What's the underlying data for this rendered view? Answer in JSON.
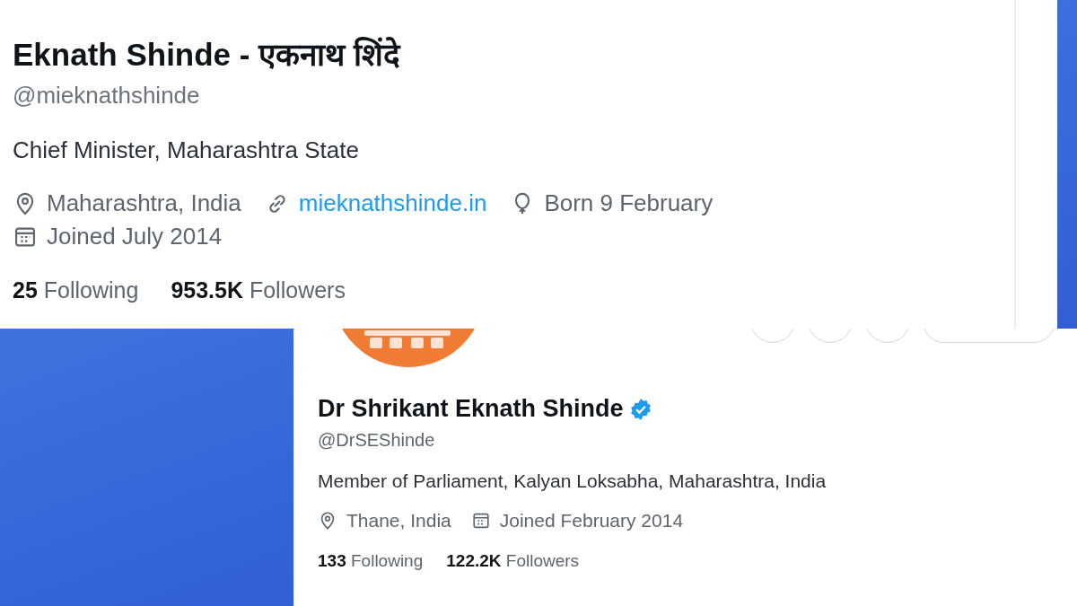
{
  "profiles": [
    {
      "name": "Eknath Shinde - एकनाथ शिंदे",
      "verified": false,
      "handle": "@mieknathshinde",
      "bio": "Chief Minister, Maharashtra State",
      "meta": [
        {
          "kind": "location",
          "text": "Maharashtra, India"
        },
        {
          "kind": "link",
          "text": "mieknathshinde.in"
        },
        {
          "kind": "birthday",
          "text": "Born 9 February"
        },
        {
          "kind": "joined",
          "text": "Joined July 2014"
        }
      ],
      "stats": [
        {
          "count": "25",
          "label": "Following"
        },
        {
          "count": "953.5K",
          "label": "Followers"
        }
      ]
    },
    {
      "name": "Dr Shrikant Eknath Shinde",
      "verified": true,
      "handle": "@DrSEShinde",
      "bio": "Member of Parliament, Kalyan Loksabha, Maharashtra, India",
      "meta": [
        {
          "kind": "location",
          "text": "Thane, India"
        },
        {
          "kind": "joined",
          "text": "Joined February 2014"
        }
      ],
      "stats": [
        {
          "count": "133",
          "label": "Following"
        },
        {
          "count": "122.2K",
          "label": "Followers"
        }
      ]
    }
  ]
}
